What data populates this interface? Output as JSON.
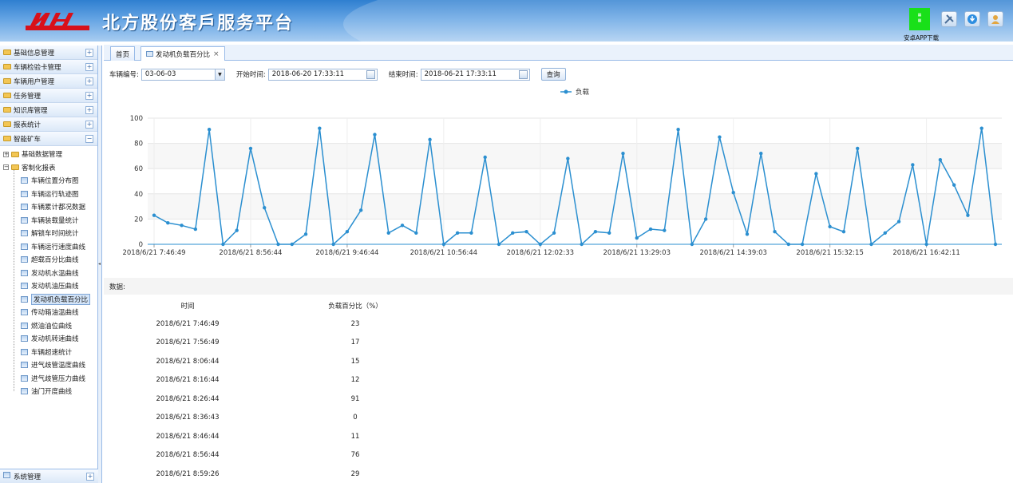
{
  "header": {
    "title": "北方股份客戶服务平台",
    "qr_text": "",
    "app_download": "安卓APP下载"
  },
  "sidebar": {
    "menus": [
      {
        "label": "基础信息管理",
        "state": "+"
      },
      {
        "label": "车辆检验卡管理",
        "state": "+"
      },
      {
        "label": "车辆用户管理",
        "state": "+"
      },
      {
        "label": "任务管理",
        "state": "+"
      },
      {
        "label": "知识库管理",
        "state": "+"
      },
      {
        "label": "报表统计",
        "state": "+"
      },
      {
        "label": "智能矿车",
        "state": "−"
      }
    ],
    "tree": {
      "node1": "基础数据管理",
      "node2": "客制化报表",
      "leaves": [
        "车辆位置分布图",
        "车辆运行轨迹图",
        "车辆累计都况数据",
        "车辆装载量统计",
        "解锁车时间统计",
        "车辆运行速度曲线",
        "超载百分比曲线",
        "发动机水温曲线",
        "发动机油压曲线",
        "发动机负载百分比",
        "传动箱油温曲线",
        "燃油油位曲线",
        "发动机转速曲线",
        "车辆超速统计",
        "进气歧管温度曲线",
        "进气歧管压力曲线",
        "油门开度曲线"
      ],
      "selected_index": 9
    },
    "footer": "系统管理",
    "footer_state": "+"
  },
  "tabs": [
    {
      "label": "首页"
    },
    {
      "label": "发动机负载百分比",
      "close": "×"
    }
  ],
  "filters": {
    "vehicle_label": "车辆编号:",
    "vehicle_value": "03-06-03",
    "start_label": "开始时间:",
    "start_value": "2018-06-20 17:33:11",
    "end_label": "结束时间:",
    "end_value": "2018-06-21 17:33:11",
    "query_button": "查询"
  },
  "chart_data": {
    "type": "line",
    "title": "",
    "xlabel": "",
    "ylabel": "",
    "ylim": [
      0,
      100
    ],
    "yticks": [
      0,
      20,
      40,
      60,
      80,
      100
    ],
    "grid": true,
    "legend_position": "top-center",
    "series": [
      {
        "name": "负载",
        "color": "#2b8fd0",
        "values": [
          23,
          17,
          15,
          12,
          91,
          0,
          11,
          76,
          29,
          0,
          0,
          8,
          92,
          0,
          10,
          27,
          87,
          9,
          15,
          9,
          83,
          0,
          9,
          9,
          69,
          0,
          9,
          10,
          0,
          9,
          68,
          0,
          10,
          9,
          72,
          5,
          12,
          11,
          91,
          0,
          20,
          85,
          41,
          8,
          72,
          10,
          0,
          0,
          56,
          14,
          10,
          76,
          0,
          9,
          18,
          63,
          0,
          67,
          47,
          23,
          92,
          0
        ]
      }
    ],
    "x_tick_labels": [
      "2018/6/21 7:46:49",
      "2018/6/21 8:56:44",
      "2018/6/21 9:46:44",
      "2018/6/21 10:56:44",
      "2018/6/21 12:02:33",
      "2018/6/21 13:29:03",
      "2018/6/21 14:39:03",
      "2018/6/21 15:32:15",
      "2018/6/21 16:42:11"
    ],
    "x_tick_indices": [
      0,
      7,
      14,
      21,
      28,
      35,
      42,
      49,
      56
    ]
  },
  "data_section": {
    "title": "数据:",
    "col_time": "时间",
    "col_load": "负载百分比（%）",
    "rows": [
      {
        "time": "2018/6/21 7:46:49",
        "value": "23"
      },
      {
        "time": "2018/6/21 7:56:49",
        "value": "17"
      },
      {
        "time": "2018/6/21 8:06:44",
        "value": "15"
      },
      {
        "time": "2018/6/21 8:16:44",
        "value": "12"
      },
      {
        "time": "2018/6/21 8:26:44",
        "value": "91"
      },
      {
        "time": "2018/6/21 8:36:43",
        "value": "0"
      },
      {
        "time": "2018/6/21 8:46:44",
        "value": "11"
      },
      {
        "time": "2018/6/21 8:56:44",
        "value": "76"
      },
      {
        "time": "2018/6/21 8:59:26",
        "value": "29"
      }
    ]
  }
}
